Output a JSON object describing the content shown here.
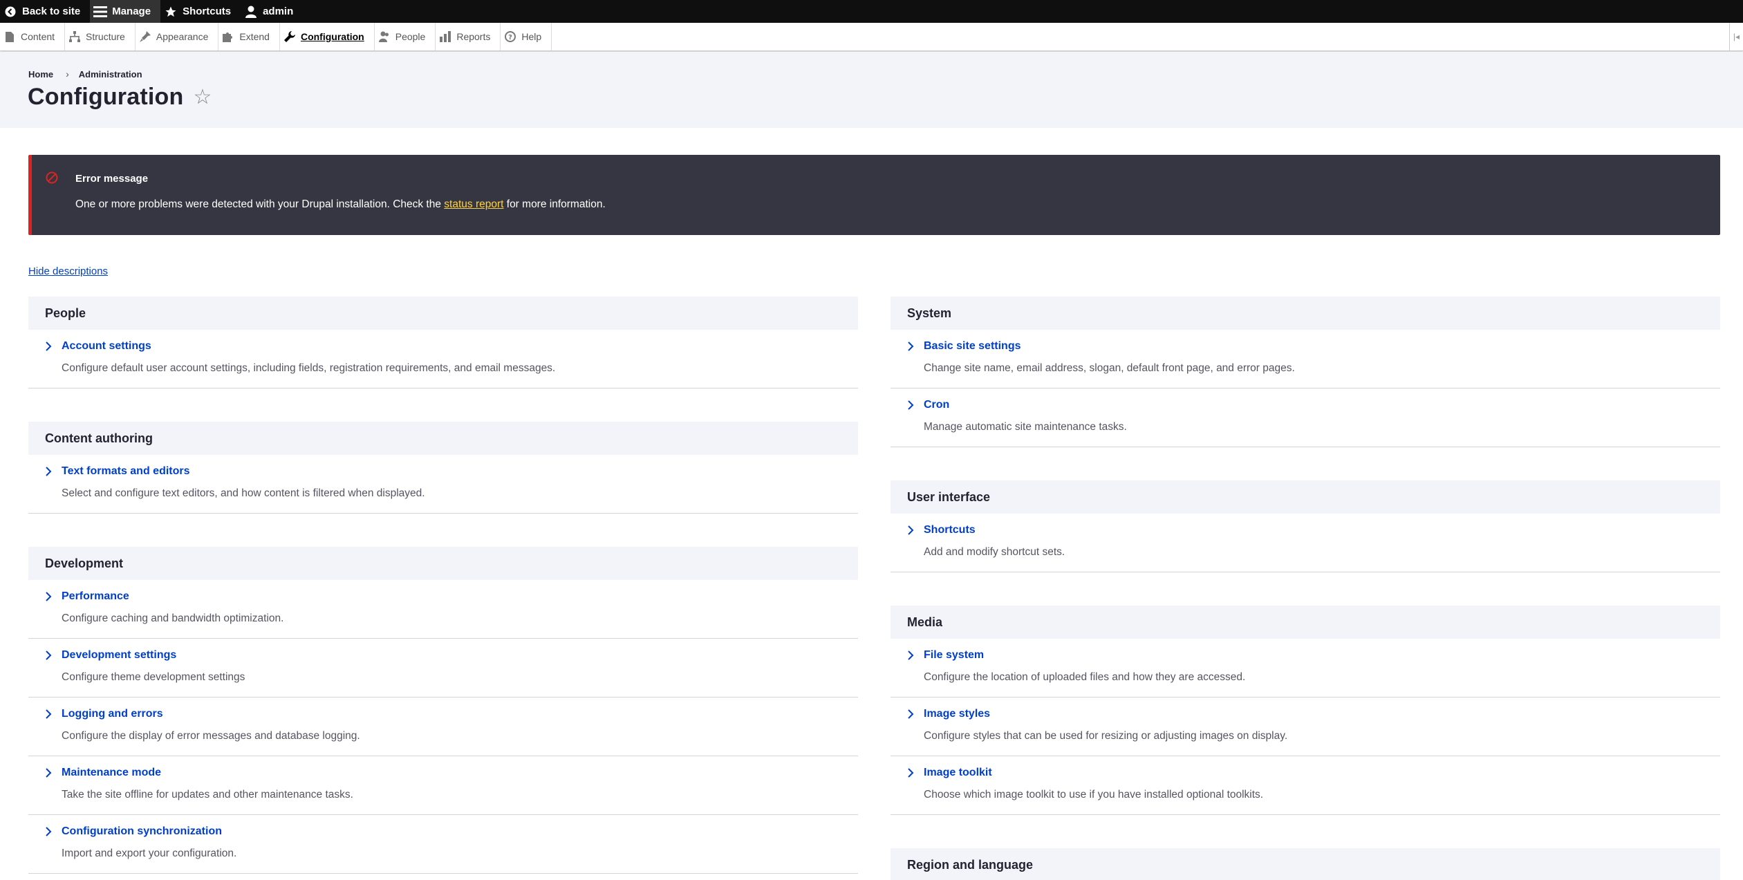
{
  "toolbar": {
    "back_to_site": "Back to site",
    "manage": "Manage",
    "shortcuts": "Shortcuts",
    "user": "admin"
  },
  "tray": {
    "items": [
      {
        "label": "Content",
        "icon": "file-icon"
      },
      {
        "label": "Structure",
        "icon": "sitemap-icon"
      },
      {
        "label": "Appearance",
        "icon": "brush-icon"
      },
      {
        "label": "Extend",
        "icon": "puzzle-icon"
      },
      {
        "label": "Configuration",
        "icon": "wrench-icon",
        "active": true
      },
      {
        "label": "People",
        "icon": "people-icon"
      },
      {
        "label": "Reports",
        "icon": "bar-chart-icon"
      },
      {
        "label": "Help",
        "icon": "help-icon"
      }
    ]
  },
  "breadcrumb": {
    "home": "Home",
    "separator": "›",
    "administration": "Administration"
  },
  "page": {
    "title": "Configuration",
    "star": "☆"
  },
  "message": {
    "title": "Error message",
    "text_before": "One or more problems were detected with your Drupal installation. Check the ",
    "link": "status report",
    "text_after": " for more information.",
    "accent_color": "#dc2323",
    "link_color": "#ffd23f"
  },
  "hide_descriptions": "Hide descriptions",
  "left_column": [
    {
      "title": "People",
      "items": [
        {
          "title": "Account settings",
          "desc": "Configure default user account settings, including fields, registration requirements, and email messages."
        }
      ]
    },
    {
      "title": "Content authoring",
      "items": [
        {
          "title": "Text formats and editors",
          "desc": "Select and configure text editors, and how content is filtered when displayed."
        }
      ]
    },
    {
      "title": "Development",
      "items": [
        {
          "title": "Performance",
          "desc": "Configure caching and bandwidth optimization."
        },
        {
          "title": "Development settings",
          "desc": "Configure theme development settings"
        },
        {
          "title": "Logging and errors",
          "desc": "Configure the display of error messages and database logging."
        },
        {
          "title": "Maintenance mode",
          "desc": "Take the site offline for updates and other maintenance tasks."
        },
        {
          "title": "Configuration synchronization",
          "desc": "Import and export your configuration."
        }
      ]
    }
  ],
  "right_column": [
    {
      "title": "System",
      "items": [
        {
          "title": "Basic site settings",
          "desc": "Change site name, email address, slogan, default front page, and error pages."
        },
        {
          "title": "Cron",
          "desc": "Manage automatic site maintenance tasks."
        }
      ]
    },
    {
      "title": "User interface",
      "items": [
        {
          "title": "Shortcuts",
          "desc": "Add and modify shortcut sets."
        }
      ]
    },
    {
      "title": "Media",
      "items": [
        {
          "title": "File system",
          "desc": "Configure the location of uploaded files and how they are accessed."
        },
        {
          "title": "Image styles",
          "desc": "Configure styles that can be used for resizing or adjusting images on display."
        },
        {
          "title": "Image toolkit",
          "desc": "Choose which image toolkit to use if you have installed optional toolkits."
        }
      ]
    },
    {
      "title": "Region and language",
      "items": []
    }
  ],
  "colors": {
    "link": "#003ecc",
    "panel_header_bg": "#f3f4f9",
    "message_bg": "#353641"
  }
}
